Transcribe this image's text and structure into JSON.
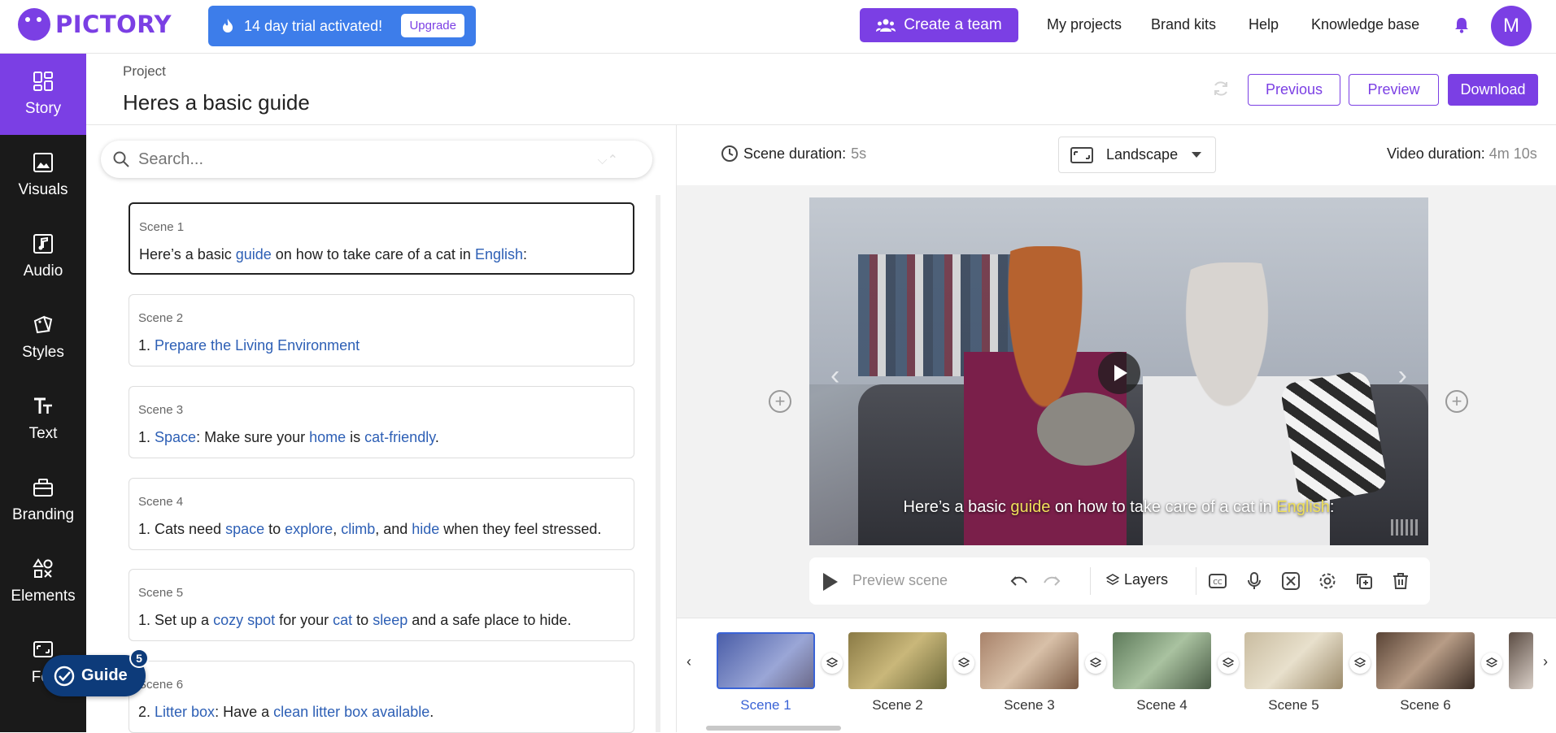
{
  "header": {
    "logo_text": "PICTORY",
    "trial_text": "14 day trial activated!",
    "upgrade_label": "Upgrade",
    "create_team_label": "Create a team",
    "nav": [
      "My projects",
      "Brand kits",
      "Help",
      "Knowledge base"
    ],
    "avatar_initial": "M",
    "accent_color": "#7b3fe4",
    "trial_color": "#3d7dea"
  },
  "sidebar": {
    "items": [
      {
        "label": "Story",
        "icon": "story-icon",
        "active": true
      },
      {
        "label": "Visuals",
        "icon": "visuals-icon"
      },
      {
        "label": "Audio",
        "icon": "audio-icon"
      },
      {
        "label": "Styles",
        "icon": "styles-icon"
      },
      {
        "label": "Text",
        "icon": "text-icon"
      },
      {
        "label": "Branding",
        "icon": "branding-icon"
      },
      {
        "label": "Elements",
        "icon": "elements-icon"
      },
      {
        "label": "For",
        "icon": "format-icon"
      }
    ]
  },
  "guide": {
    "label": "Guide",
    "badge": "5"
  },
  "project": {
    "label": "Project",
    "title": "Heres a basic guide",
    "buttons": {
      "previous": "Previous",
      "preview": "Preview",
      "download": "Download"
    }
  },
  "search": {
    "placeholder": "Search..."
  },
  "scenes": [
    {
      "label": "Scene 1",
      "parts": [
        [
          "Here’s a basic ",
          false
        ],
        [
          "guide",
          true
        ],
        [
          " on how to take care of a cat in ",
          false
        ],
        [
          "English",
          true
        ],
        [
          ":",
          false
        ]
      ]
    },
    {
      "label": "Scene 2",
      "parts": [
        [
          "1. ",
          false
        ],
        [
          "Prepare the Living Environment",
          true
        ]
      ]
    },
    {
      "label": "Scene 3",
      "parts": [
        [
          "1. ",
          false
        ],
        [
          "Space",
          true
        ],
        [
          ": Make sure your ",
          false
        ],
        [
          "home",
          true
        ],
        [
          " is ",
          false
        ],
        [
          "cat-friendly",
          true
        ],
        [
          ".",
          false
        ]
      ]
    },
    {
      "label": "Scene 4",
      "parts": [
        [
          "1. Cats need ",
          false
        ],
        [
          "space",
          true
        ],
        [
          " to ",
          false
        ],
        [
          "explore",
          true
        ],
        [
          ", ",
          false
        ],
        [
          "climb",
          true
        ],
        [
          ", and ",
          false
        ],
        [
          "hide",
          true
        ],
        [
          " when they feel stressed.",
          false
        ]
      ]
    },
    {
      "label": "Scene 5",
      "parts": [
        [
          "1. Set up a ",
          false
        ],
        [
          "cozy spot",
          true
        ],
        [
          " for your ",
          false
        ],
        [
          "cat",
          true
        ],
        [
          " to ",
          false
        ],
        [
          "sleep",
          true
        ],
        [
          " and a safe place to hide.",
          false
        ]
      ]
    },
    {
      "label": "Scene 6",
      "parts": [
        [
          "2. ",
          false
        ],
        [
          "Litter box",
          true
        ],
        [
          ": Have a ",
          false
        ],
        [
          "clean litter box available",
          true
        ],
        [
          ".",
          false
        ]
      ]
    }
  ],
  "editor": {
    "scene_duration_label": "Scene duration:",
    "scene_duration_value": "5s",
    "orientation": "Landscape",
    "video_duration_label": "Video duration:",
    "video_duration_value": "4m 10s",
    "caption_parts": [
      [
        "Here’s a basic ",
        false
      ],
      [
        "guide",
        true
      ],
      [
        " on how to take care of a cat in ",
        false
      ],
      [
        "English",
        true
      ],
      [
        ":",
        false
      ]
    ],
    "preview_scene_label": "Preview scene",
    "layers_label": "Layers"
  },
  "timeline": {
    "thumbs": [
      "Scene 1",
      "Scene 2",
      "Scene 3",
      "Scene 4",
      "Scene 5",
      "Scene 6"
    ],
    "active_index": 0
  }
}
